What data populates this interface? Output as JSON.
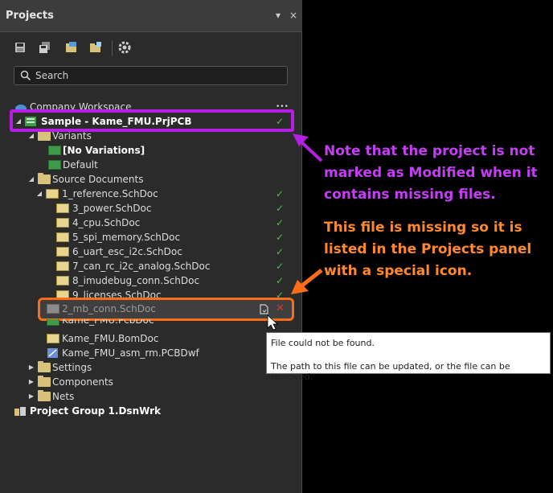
{
  "panel": {
    "title": "Projects",
    "controls": {
      "dropdown": "▾",
      "close": "×"
    }
  },
  "toolbar": [
    {
      "name": "save-icon"
    },
    {
      "name": "save-all-icon"
    },
    {
      "name": "open-project-icon"
    },
    {
      "name": "add-existing-icon"
    },
    {
      "name": "gear-icon"
    }
  ],
  "search": {
    "placeholder": "Search"
  },
  "tree": {
    "workspace": "Company Workspace",
    "workspace_menu": "•••",
    "project": "Sample - Kame_FMU.PrjPCB",
    "variants": "Variants",
    "no_variations": "[No Variations]",
    "default": "Default",
    "source_documents": "Source Documents",
    "reference": "1_reference.SchDoc",
    "docs": [
      "3_power.SchDoc",
      "4_cpu.SchDoc",
      "5_spi_memory.SchDoc",
      "6_uart_esc_i2c.SchDoc",
      "7_can_rc_i2c_analog.SchDoc",
      "8_imudebug_conn.SchDoc",
      "9_licenses.SchDoc"
    ],
    "missing_doc": "2_mb_conn.SchDoc",
    "pcb_doc": "Kame_FMU.PcbDoc",
    "bom_doc": "Kame_FMU.BomDoc",
    "pcbdwf_doc": "Kame_FMU_asm_rm.PCBDwf",
    "settings": "Settings",
    "components": "Components",
    "nets": "Nets",
    "project_group": "Project Group 1.DsnWrk"
  },
  "tooltip": {
    "line1": "File could not be found.",
    "line2": "The path to this file can be updated, or the file can be removed."
  },
  "annotations": {
    "note_purple": "Note that the project is not marked as Modified when it contains missing files.",
    "note_orange": "This file is missing so it is listed in the Projects panel with a special icon."
  },
  "colors": {
    "purple": "#b41fe3",
    "orange": "#ff6c17",
    "check": "#48c048",
    "missing_x": "#e03030"
  }
}
